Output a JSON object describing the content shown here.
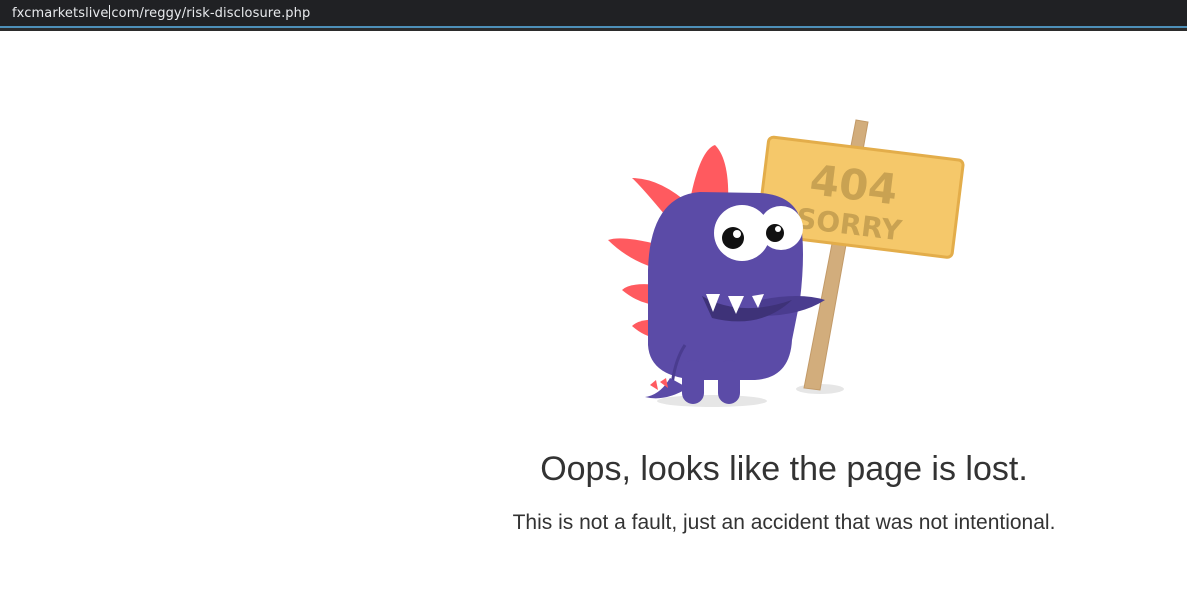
{
  "browser": {
    "url_host": "fxcmarketslive",
    "url_rest": "com/reggy/risk-disclosure.php"
  },
  "illustration": {
    "icon": "monster-404-sign-icon",
    "sign_line1": "404",
    "sign_line2": "SORRY",
    "colors": {
      "monster": "#5b4ba7",
      "spikes": "#ff5a5f",
      "sign": "#f5c86a",
      "pole": "#d2ad7c"
    }
  },
  "message": {
    "title": "Oops, looks like the page is lost.",
    "subtitle": "This is not a fault, just an accident that was not intentional."
  }
}
